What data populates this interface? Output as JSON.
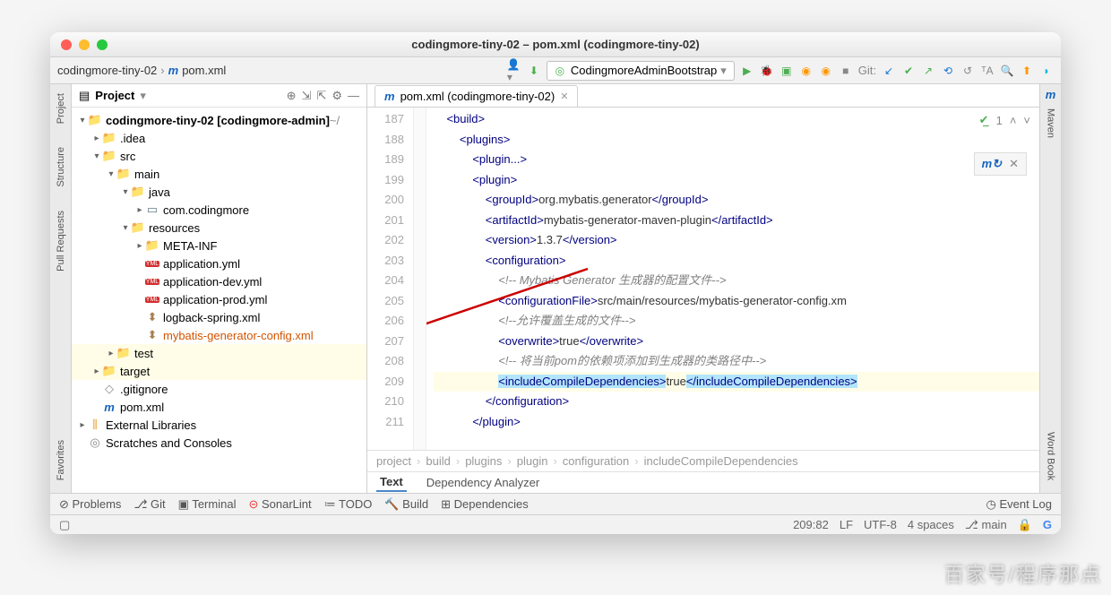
{
  "window": {
    "title": "codingmore-tiny-02 – pom.xml (codingmore-tiny-02)"
  },
  "breadcrumb": {
    "project": "codingmore-tiny-02",
    "file": "pom.xml"
  },
  "runConfig": {
    "name": "CodingmoreAdminBootstrap"
  },
  "toolbar": {
    "git_label": "Git:"
  },
  "leftTabs": {
    "project": "Project",
    "structure": "Structure",
    "pull": "Pull Requests",
    "favorites": "Favorites"
  },
  "rightTabs": {
    "maven": "Maven",
    "wordbook": "Word Book"
  },
  "projectPanel": {
    "title": "Project",
    "root": "codingmore-tiny-02",
    "rootTag": "[codingmore-admin]",
    "rootExtra": " ~/",
    "tree": {
      "idea": ".idea",
      "src": "src",
      "main": "main",
      "java": "java",
      "pkg": "com.codingmore",
      "resources": "resources",
      "metainf": "META-INF",
      "app": "application.yml",
      "appdev": "application-dev.yml",
      "appprod": "application-prod.yml",
      "logback": "logback-spring.xml",
      "mybatis": "mybatis-generator-config.xml",
      "test": "test",
      "target": "target",
      "gitignore": ".gitignore",
      "pom": "pom.xml",
      "extlib": "External Libraries",
      "scratches": "Scratches and Consoles"
    }
  },
  "editorTab": {
    "label": "pom.xml (codingmore-tiny-02)"
  },
  "gutter": [
    "187",
    "188",
    "189",
    "199",
    "200",
    "201",
    "202",
    "203",
    "204",
    "205",
    "206",
    "207",
    "208",
    "209",
    "210",
    "211"
  ],
  "inspections": {
    "count": "1"
  },
  "code": {
    "build_open": "<build>",
    "plugins_open": "<plugins>",
    "plugin_collapsed": "<plugin...>",
    "plugin_open": "<plugin>",
    "groupId_open": "<groupId>",
    "groupId_text": "org.mybatis.generator",
    "groupId_close": "</groupId>",
    "artifactId_open": "<artifactId>",
    "artifactId_text": "mybatis-generator-maven-plugin",
    "artifactId_close": "</artifactId>",
    "version_open": "<version>",
    "version_text": "1.3.7",
    "version_close": "</version>",
    "config_open": "<configuration>",
    "cmt1": "<!-- Mybatis Generator 生成器的配置文件-->",
    "cfgfile_open": "<configurationFile>",
    "cfgfile_text": "src/main/resources/mybatis-generator-config.xm",
    "cfgfile_close": "",
    "cmt2": "<!--允许覆盖生成的文件-->",
    "overwrite_open": "<overwrite>",
    "overwrite_text": "true",
    "overwrite_close": "</overwrite>",
    "cmt3": "<!-- 将当前pom的依赖项添加到生成器的类路径中-->",
    "include_open": "<includeCompileDependencies>",
    "include_text": "true",
    "include_close": "</includeCompileDependencies>",
    "config_close": "</configuration>",
    "plugin_close": "</plugin>"
  },
  "crumbs": [
    "project",
    "build",
    "plugins",
    "plugin",
    "configuration",
    "includeCompileDependencies"
  ],
  "subtabs": {
    "text": "Text",
    "dep": "Dependency Analyzer"
  },
  "bottom": {
    "problems": "Problems",
    "git": "Git",
    "terminal": "Terminal",
    "sonar": "SonarLint",
    "todo": "TODO",
    "build": "Build",
    "deps": "Dependencies",
    "eventlog": "Event Log"
  },
  "status": {
    "caret": "209:82",
    "lf": "LF",
    "enc": "UTF-8",
    "indent": "4 spaces",
    "branch": "main"
  },
  "watermark": "百家号/程序那点"
}
